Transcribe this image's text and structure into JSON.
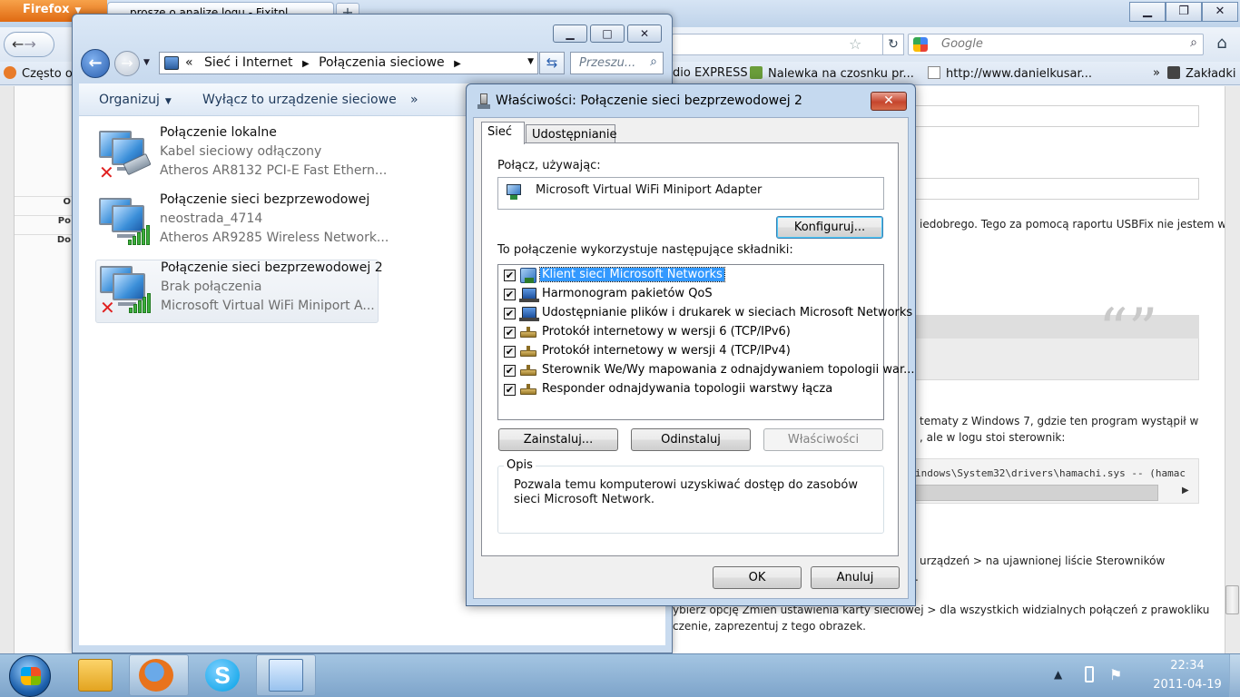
{
  "firefox": {
    "menu_label": "Firefox",
    "tab_title": "prosze o analize logu - Fixitpl",
    "search_placeholder": "Google",
    "bookmarks": [
      {
        "label": "Często odwiedzane",
        "icon": "firefox-bookmark-icon"
      },
      {
        "label": "dio EXPRESS",
        "icon": "page-icon"
      },
      {
        "label": "Nalewka na czosnku pr...",
        "icon": "page-icon"
      },
      {
        "label": "http://www.danielkusar...",
        "icon": "page-icon"
      },
      {
        "label": "»",
        "icon": "chevron-icon"
      },
      {
        "label": "Zakładki",
        "icon": "bookmarks-icon"
      }
    ],
    "page": {
      "left_labels": [
        "O",
        "Po",
        "Do"
      ],
      "text_1": "iedobrego. Tego za pomocą raportu USBFix nie jestem w",
      "quote_mark": "“”",
      "text_2": "tematy z Windows 7, gdzie ten program wystąpił w",
      "text_3": ", ale w logu stoi sterownik:",
      "code": "indows\\System32\\drivers\\hamachi.sys -- (hamac",
      "text_4": "urządzeń > na ujawnionej liście Sterowników",
      "text_5": ".",
      "text_6": "ybierz opcję Zmień ustawienia karty sieciowej > dla wszystkich widzialnych połączeń z prawokliku",
      "text_7": "czenie, zaprezentuj z tego obrazek."
    }
  },
  "explorer": {
    "window_controls": {
      "minimize": "▁",
      "maximize": "□",
      "close": "✕"
    },
    "address": {
      "prefix": "«",
      "crumbs": [
        "Sieć i Internet",
        "Połączenia sieciowe"
      ],
      "separator": "▶"
    },
    "search_placeholder": "Przeszu...",
    "commands": {
      "organize": "Organizuj",
      "disable": "Wyłącz to urządzenie sieciowe",
      "more": "»"
    },
    "connections": [
      {
        "name": "Połączenie lokalne",
        "status": "Kabel sieciowy odłączony",
        "device": "Atheros AR8132 PCI-E Fast Ethern...",
        "icon": "wired-connection-icon",
        "error": true
      },
      {
        "name": "Połączenie sieci bezprzewodowej",
        "status": "neostrada_4714",
        "device": "Atheros AR9285 Wireless Network...",
        "icon": "wireless-connection-icon",
        "error": false
      },
      {
        "name": "Połączenie sieci bezprzewodowej 2",
        "status": "Brak połączenia",
        "device": "Microsoft Virtual WiFi Miniport A...",
        "icon": "wireless-connection-icon",
        "error": true,
        "selected": true
      }
    ]
  },
  "dialog": {
    "title": "Właściwości: Połączenie sieci bezprzewodowej 2",
    "close_label": "✕",
    "tabs": [
      "Sieć",
      "Udostępnianie"
    ],
    "connect_using_label": "Połącz, używając:",
    "adapter_name": "Microsoft Virtual WiFi Miniport Adapter",
    "configure_label": "Konfiguruj...",
    "components_label": "To połączenie wykorzystuje następujące składniki:",
    "components": [
      {
        "label": "Klient sieci Microsoft Networks",
        "checked": true,
        "icon": "client-icon",
        "selected": true
      },
      {
        "label": "Harmonogram pakietów QoS",
        "checked": true,
        "icon": "network-service-icon"
      },
      {
        "label": "Udostępnianie plików i drukarek w sieciach Microsoft Networks",
        "checked": true,
        "icon": "network-service-icon"
      },
      {
        "label": "Protokół internetowy w wersji 6 (TCP/IPv6)",
        "checked": true,
        "icon": "protocol-icon"
      },
      {
        "label": "Protokół internetowy w wersji 4 (TCP/IPv4)",
        "checked": true,
        "icon": "protocol-icon"
      },
      {
        "label": "Sterownik We/Wy mapowania z odnajdywaniem topologii war...",
        "checked": true,
        "icon": "protocol-icon"
      },
      {
        "label": "Responder odnajdywania topologii warstwy łącza",
        "checked": true,
        "icon": "protocol-icon"
      }
    ],
    "check_mark": "✔",
    "install_label": "Zainstaluj...",
    "uninstall_label": "Odinstaluj",
    "properties_label": "Właściwości",
    "description_label": "Opis",
    "description_text": "Pozwala temu komputerowi uzyskiwać dostęp do zasobów sieci Microsoft Network.",
    "ok_label": "OK",
    "cancel_label": "Anuluj"
  },
  "taskbar": {
    "time": "22:34",
    "date": "2011-04-19",
    "tray_arrow": "▲",
    "tray_flag": "⚑"
  }
}
